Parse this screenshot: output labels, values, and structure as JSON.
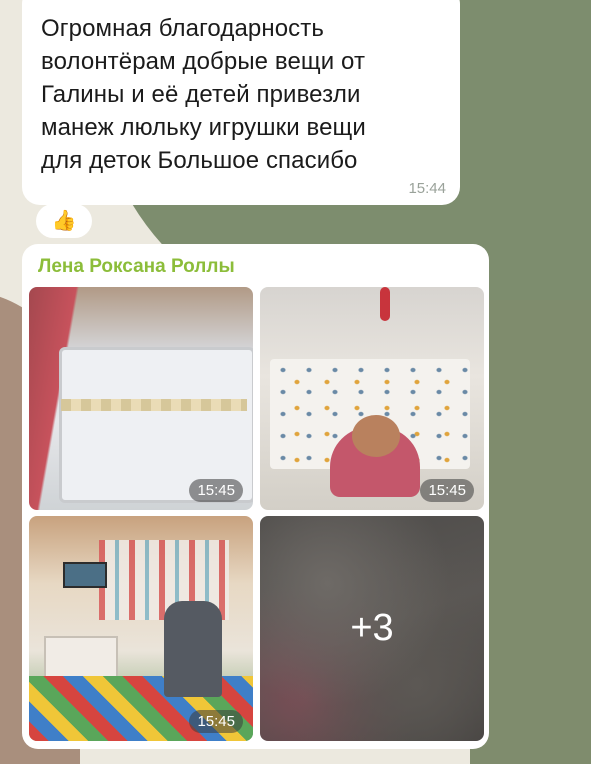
{
  "message": {
    "text": "Огромная благодарность\nволонтёрам добрые вещи от\nГалины и её детей привезли\nманеж люльку игрушки вещи\nдля деток Большое спасибо",
    "time": "15:44",
    "reaction": "thumbs-up-emoji"
  },
  "media_message": {
    "sender": "Лена Роксана Роллы",
    "photos": [
      {
        "time": "15:45"
      },
      {
        "time": "15:45"
      },
      {
        "time": "15:45"
      }
    ],
    "more_count": "+3"
  },
  "colors": {
    "sender_name": "#8cbd3a",
    "wallpaper_green": "#7d8d6e",
    "bubble": "#ffffff"
  }
}
